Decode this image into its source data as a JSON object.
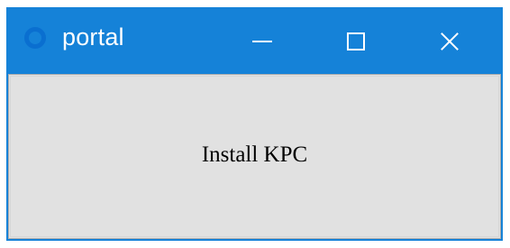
{
  "window": {
    "title": "portal",
    "icon": "app-ring-icon",
    "accent": "#1582d8"
  },
  "controls": {
    "minimize": "minimize-icon",
    "maximize": "maximize-icon",
    "close": "close-icon"
  },
  "content": {
    "button_label": "Install KPC"
  }
}
